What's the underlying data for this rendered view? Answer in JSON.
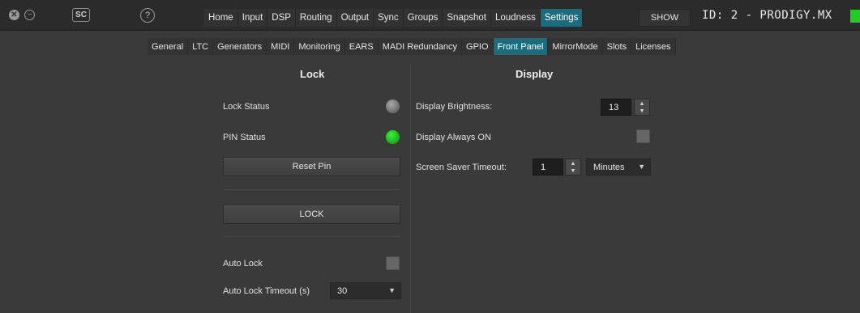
{
  "window": {
    "sc_label": "SC",
    "help_label": "?",
    "show_label": "SHOW",
    "id_label": "ID: 2 - PRODIGY.MX",
    "status_color": "#22cc22"
  },
  "nav": {
    "items": [
      "Home",
      "Input",
      "DSP",
      "Routing",
      "Output",
      "Sync",
      "Groups",
      "Snapshot",
      "Loudness",
      "Settings"
    ],
    "active": "Settings"
  },
  "subtabs": {
    "items": [
      "General",
      "LTC",
      "Generators",
      "MIDI",
      "Monitoring",
      "EARS",
      "MADI Redundancy",
      "GPIO",
      "Front Panel",
      "MirrorMode",
      "Slots",
      "Licenses"
    ],
    "active": "Front Panel"
  },
  "lock": {
    "title": "Lock",
    "lock_status_label": "Lock Status",
    "pin_status_label": "PIN Status",
    "reset_pin_label": "Reset Pin",
    "lock_button_label": "LOCK",
    "auto_lock_label": "Auto Lock",
    "auto_lock_timeout_label": "Auto Lock Timeout (s)",
    "auto_lock_timeout_value": "30"
  },
  "display": {
    "title": "Display",
    "brightness_label": "Display Brightness:",
    "brightness_value": "13",
    "always_on_label": "Display Always ON",
    "screensaver_label": "Screen Saver Timeout:",
    "screensaver_value": "1",
    "screensaver_unit": "Minutes"
  }
}
